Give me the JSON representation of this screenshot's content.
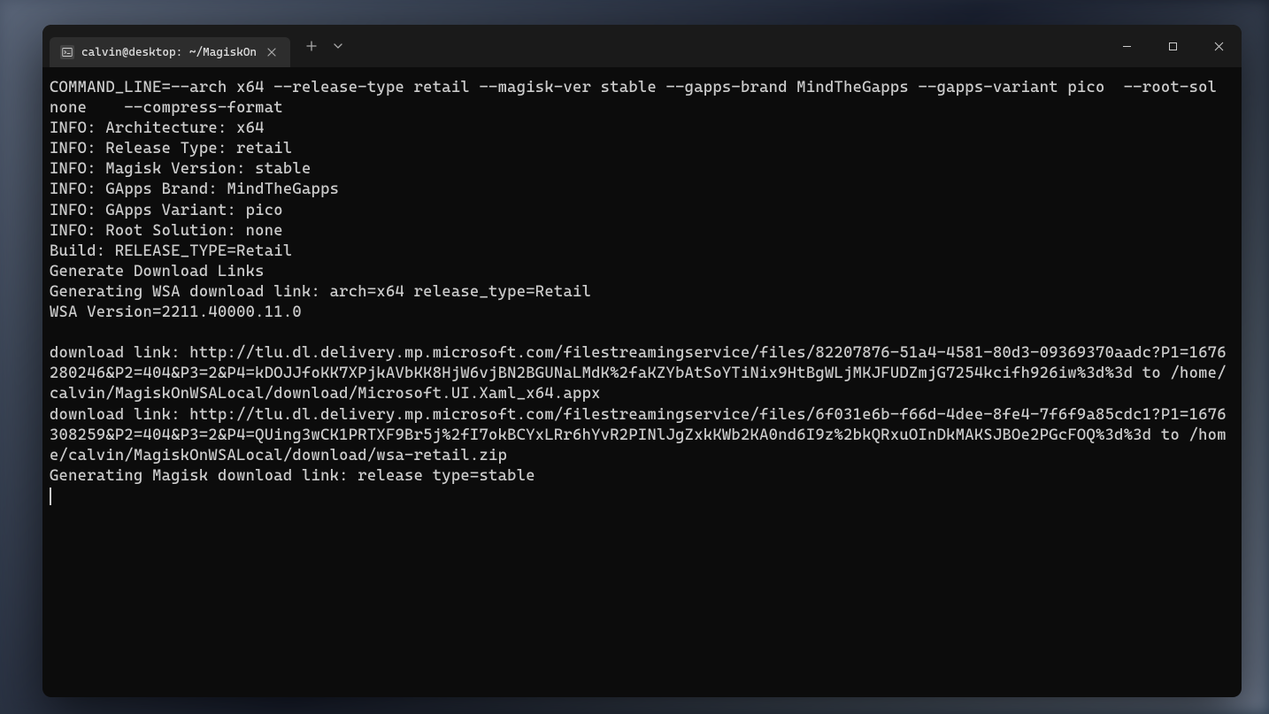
{
  "titlebar": {
    "tab": {
      "title": "calvin@desktop: ~/MagiskOn"
    }
  },
  "terminal": {
    "lines": [
      "COMMAND_LINE=--arch x64 --release-type retail --magisk-ver stable --gapps-brand MindTheGapps --gapps-variant pico  --root-sol none    --compress-format",
      "INFO: Architecture: x64",
      "INFO: Release Type: retail",
      "INFO: Magisk Version: stable",
      "INFO: GApps Brand: MindTheGapps",
      "INFO: GApps Variant: pico",
      "INFO: Root Solution: none",
      "Build: RELEASE_TYPE=Retail",
      "Generate Download Links",
      "Generating WSA download link: arch=x64 release_type=Retail",
      "WSA Version=2211.40000.11.0",
      "",
      "download link: http://tlu.dl.delivery.mp.microsoft.com/filestreamingservice/files/82207876-51a4-4581-80d3-09369370aadc?P1=1676280246&P2=404&P3=2&P4=kDOJJfoKK7XPjkAVbKK8HjW6vjBN2BGUNaLMdK%2faKZYbAtSoYTiNix9HtBgWLjMKJFUDZmjG7254kcifh926iw%3d%3d to /home/calvin/MagiskOnWSALocal/download/Microsoft.UI.Xaml_x64.appx",
      "download link: http://tlu.dl.delivery.mp.microsoft.com/filestreamingservice/files/6f031e6b-f66d-4dee-8fe4-7f6f9a85cdc1?P1=1676308259&P2=404&P3=2&P4=QUing3wCK1PRTXF9Br5j%2fI7okBCYxLRr6hYvR2PINlJgZxkKWb2KA0nd6I9z%2bkQRxuOInDkMAKSJBOe2PGcFOQ%3d%3d to /home/calvin/MagiskOnWSALocal/download/wsa-retail.zip",
      "Generating Magisk download link: release type=stable"
    ]
  }
}
